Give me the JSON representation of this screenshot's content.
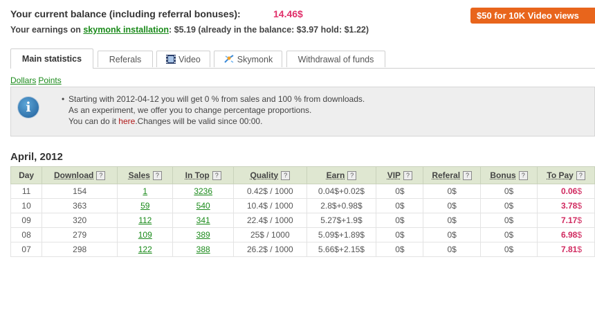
{
  "header": {
    "balance_label": "Your current balance (including referral bonuses):",
    "balance_value": "14.46$",
    "promo_button": "$50 for 10K Video views",
    "earnings_prefix": "Your earnings on",
    "earnings_link": "skymonk installation",
    "earnings_suffix": ": $5.19 (already in the balance: $3.97 hold: $1.22)"
  },
  "tabs": [
    {
      "label": "Main statistics",
      "icon": null,
      "active": true
    },
    {
      "label": "Referals",
      "icon": null,
      "active": false
    },
    {
      "label": "Video",
      "icon": "film-icon",
      "active": false
    },
    {
      "label": "Skymonk",
      "icon": "skymonk-icon",
      "active": false
    },
    {
      "label": "Withdrawal of funds",
      "icon": null,
      "active": false
    }
  ],
  "units": {
    "dollars": "Dollars",
    "points": "Points"
  },
  "notice": {
    "line1": "Starting with 2012-04-12 you will get 0 % from sales and 100 % from downloads.",
    "line2": "As an experiment, we offer you to change percentage proportions.",
    "line3_prefix": "You can do it",
    "line3_link": "here",
    "line3_suffix": ".Changes will be valid since 00:00."
  },
  "month": "April, 2012",
  "table": {
    "columns": [
      "Day",
      "Download",
      "Sales",
      "In Top",
      "Quality",
      "Earn",
      "VIP",
      "Referal",
      "Bonus",
      "To Pay"
    ],
    "rows": [
      {
        "day": "11",
        "download": "154",
        "sales": "1",
        "in_top": "3236",
        "quality": "0.42$ / 1000",
        "earn": "0.04$+0.02$",
        "vip": "0$",
        "referal": "0$",
        "bonus": "0$",
        "to_pay_num": "0.06",
        "to_pay_cur": "$"
      },
      {
        "day": "10",
        "download": "363",
        "sales": "59",
        "in_top": "540",
        "quality": "10.4$ / 1000",
        "earn": "2.8$+0.98$",
        "vip": "0$",
        "referal": "0$",
        "bonus": "0$",
        "to_pay_num": "3.78",
        "to_pay_cur": "$"
      },
      {
        "day": "09",
        "download": "320",
        "sales": "112",
        "in_top": "341",
        "quality": "22.4$ / 1000",
        "earn": "5.27$+1.9$",
        "vip": "0$",
        "referal": "0$",
        "bonus": "0$",
        "to_pay_num": "7.17",
        "to_pay_cur": "$"
      },
      {
        "day": "08",
        "download": "279",
        "sales": "109",
        "in_top": "389",
        "quality": "25$ / 1000",
        "earn": "5.09$+1.89$",
        "vip": "0$",
        "referal": "0$",
        "bonus": "0$",
        "to_pay_num": "6.98",
        "to_pay_cur": "$"
      },
      {
        "day": "07",
        "download": "298",
        "sales": "122",
        "in_top": "388",
        "quality": "26.2$ / 1000",
        "earn": "5.66$+2.15$",
        "vip": "0$",
        "referal": "0$",
        "bonus": "0$",
        "to_pay_num": "7.81",
        "to_pay_cur": "$"
      }
    ]
  },
  "colors": {
    "accent_pink": "#e0306a",
    "link_green": "#1a8a1a",
    "promo_orange": "#e8651c",
    "header_row": "#dfe7d1"
  }
}
